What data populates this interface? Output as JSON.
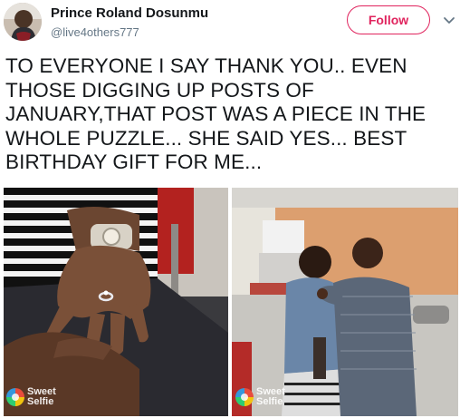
{
  "header": {
    "display_name": "Prince Roland Dosunmu",
    "handle": "@live4others777",
    "follow_label": "Follow",
    "accent_color": "#e0245e"
  },
  "tweet": {
    "text": "TO EVERYONE I SAY THANK YOU.. EVEN THOSE DIGGING UP POSTS OF JANUARY,THAT POST WAS A PIECE IN THE WHOLE PUZZLE... SHE SAID YES... BEST BIRTHDAY GIFT FOR ME..."
  },
  "media": [
    {
      "subject": "hand with engagement ring",
      "watermark": "Sweet\nSelfie"
    },
    {
      "subject": "couple embracing in kitchen",
      "watermark": "Sweet\nSelfie"
    }
  ],
  "icons": {
    "caret": "chevron-down-icon",
    "watermark_logo": "sweet-selfie-logo"
  }
}
